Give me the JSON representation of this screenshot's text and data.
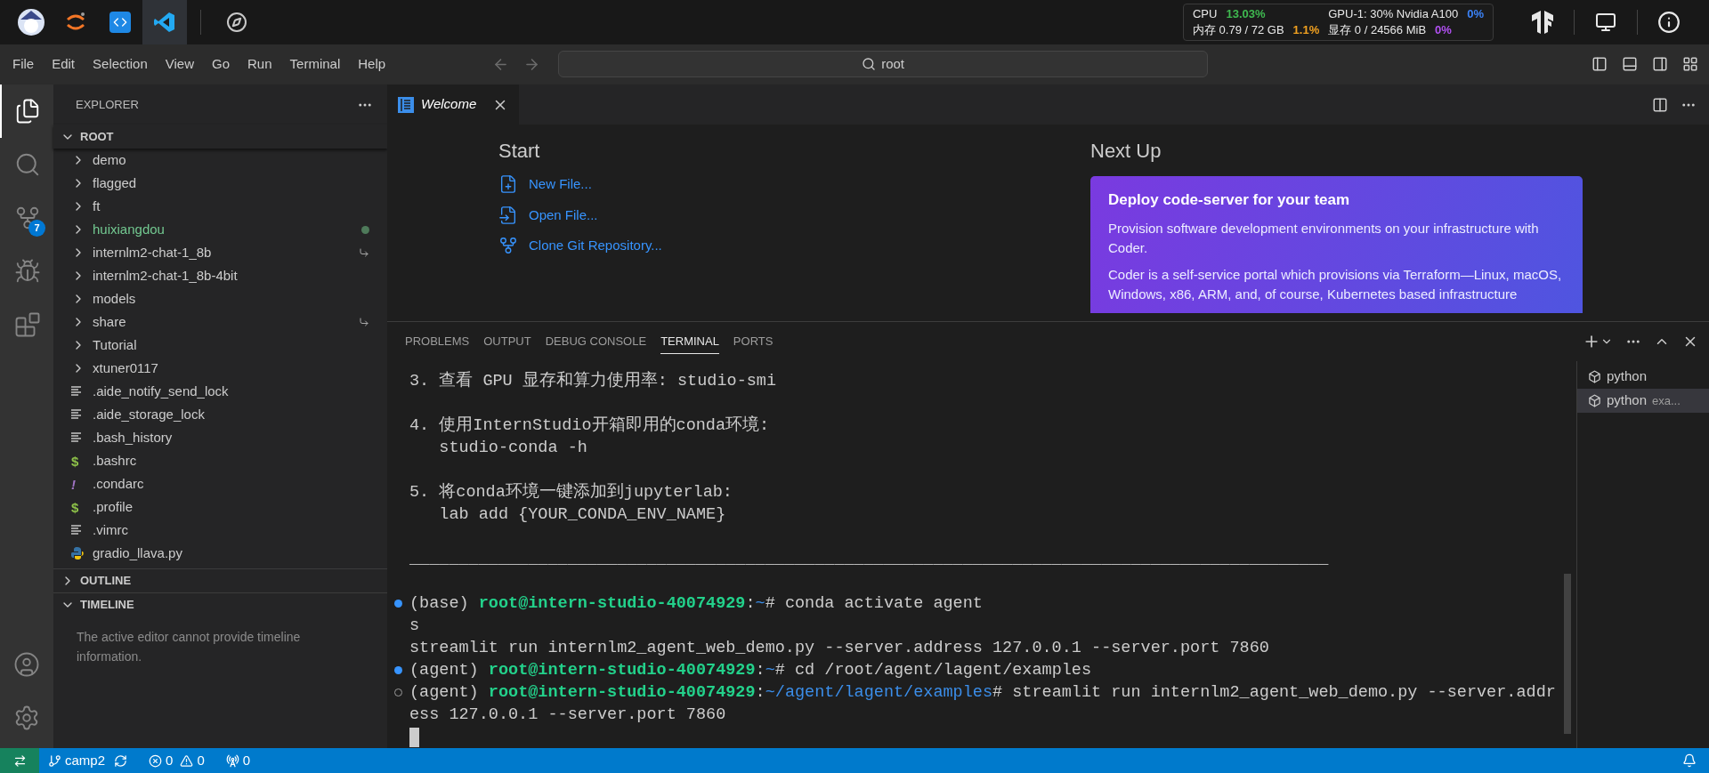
{
  "topbar": {
    "apps": [
      {
        "kind": "mascot",
        "selected": false
      },
      {
        "kind": "jupyter",
        "selected": false
      },
      {
        "kind": "code",
        "selected": false
      },
      {
        "kind": "vscode",
        "selected": true
      },
      {
        "kind": "compass",
        "selected": false
      }
    ],
    "monitor": [
      [
        {
          "label": "CPU",
          "value": "13.03%",
          "color": "#3fb950"
        },
        {
          "label": "GPU-1: 30% Nvidia A100",
          "value": "0%",
          "color": "#3b82f6"
        }
      ],
      [
        {
          "label": "内存 0.79 / 72 GB",
          "value": "1.1%",
          "color": "#f0a020"
        },
        {
          "label": "显存 0 / 24566 MiB",
          "value": "0%",
          "color": "#b050f0"
        }
      ]
    ],
    "right_icons": [
      {
        "kind": "tf"
      },
      {
        "kind": "monitor"
      },
      {
        "kind": "info"
      }
    ]
  },
  "menu": [
    "File",
    "Edit",
    "Selection",
    "View",
    "Go",
    "Run",
    "Terminal",
    "Help"
  ],
  "command_center": {
    "title": "root"
  },
  "activity_bar": {
    "items": [
      {
        "kind": "explorer",
        "selected": true
      },
      {
        "kind": "search",
        "selected": false
      },
      {
        "kind": "source_control",
        "selected": false,
        "badge": "7"
      },
      {
        "kind": "run_debug",
        "selected": false
      },
      {
        "kind": "extensions",
        "selected": false
      }
    ],
    "bottom": [
      {
        "kind": "accounts"
      },
      {
        "kind": "settings"
      }
    ]
  },
  "sidebar": {
    "title": "EXPLORER",
    "section": "ROOT",
    "items": [
      {
        "kind": "folder",
        "name": "demo"
      },
      {
        "kind": "folder",
        "name": "flagged"
      },
      {
        "kind": "folder",
        "name": "ft"
      },
      {
        "kind": "folder",
        "name": "huixiangdou",
        "untracked": true
      },
      {
        "kind": "folder",
        "name": "internlm2-chat-1_8b",
        "symlink": true
      },
      {
        "kind": "folder",
        "name": "internlm2-chat-1_8b-4bit"
      },
      {
        "kind": "folder",
        "name": "models"
      },
      {
        "kind": "folder",
        "name": "share",
        "symlink": true
      },
      {
        "kind": "folder",
        "name": "Tutorial"
      },
      {
        "kind": "folder",
        "name": "xtuner0117"
      },
      {
        "kind": "text",
        "name": ".aide_notify_send_lock"
      },
      {
        "kind": "text",
        "name": ".aide_storage_lock"
      },
      {
        "kind": "text",
        "name": ".bash_history"
      },
      {
        "kind": "shell",
        "glyph": "$",
        "name": ".bashrc"
      },
      {
        "kind": "config",
        "glyph": "!",
        "name": ".condarc"
      },
      {
        "kind": "shell",
        "glyph": "$",
        "name": ".profile"
      },
      {
        "kind": "text",
        "name": ".vimrc"
      },
      {
        "kind": "python",
        "name": "gradio_llava.py"
      }
    ],
    "outline": {
      "title": "OUTLINE",
      "expanded": false
    },
    "timeline": {
      "title": "TIMELINE",
      "expanded": true,
      "message": "The active editor cannot provide timeline information."
    }
  },
  "editor": {
    "tabs": [
      {
        "label": "Welcome",
        "selected": true
      }
    ],
    "start": {
      "title": "Start",
      "actions": [
        {
          "kind": "new_file",
          "label": "New File..."
        },
        {
          "kind": "open_file",
          "label": "Open File..."
        },
        {
          "kind": "clone",
          "label": "Clone Git Repository..."
        }
      ]
    },
    "next_up": {
      "title": "Next Up",
      "card": {
        "title": "Deploy code-server for your team",
        "paragraphs": [
          "Provision software development environments on your infrastructure with Coder.",
          "Coder is a self-service portal which provisions via Terraform—Linux, macOS, Windows, x86, ARM, and, of course, Kubernetes based infrastructure"
        ]
      }
    }
  },
  "panel": {
    "tabs": [
      {
        "label": "PROBLEMS",
        "selected": false
      },
      {
        "label": "OUTPUT",
        "selected": false
      },
      {
        "label": "DEBUG CONSOLE",
        "selected": false
      },
      {
        "label": "TERMINAL",
        "selected": true
      },
      {
        "label": "PORTS",
        "selected": false
      }
    ],
    "terminal_lines": [
      {
        "kind": "text",
        "text": "3. 查看 GPU 显存和算力使用率: studio-smi"
      },
      {
        "kind": "blank"
      },
      {
        "kind": "text",
        "text": "4. 使用InternStudio开箱即用的conda环境:"
      },
      {
        "kind": "text",
        "text": "   studio-conda -h"
      },
      {
        "kind": "blank"
      },
      {
        "kind": "text",
        "text": "5. 将conda环境一键添加到jupyterlab:"
      },
      {
        "kind": "text",
        "text": "   lab add {YOUR_CONDA_ENV_NAME}"
      },
      {
        "kind": "blank"
      },
      {
        "kind": "text",
        "text": "_____________________________________________________________________________________________"
      },
      {
        "kind": "blank"
      },
      {
        "kind": "prompt",
        "finished": true,
        "env": "(base) ",
        "user": "root@intern-studio-40074929",
        "sep": ":",
        "path": "~",
        "command": "# conda activate agent"
      },
      {
        "kind": "text",
        "text": "s"
      },
      {
        "kind": "text",
        "text": "streamlit run internlm2_agent_web_demo.py --server.address 127.0.0.1 --server.port 7860"
      },
      {
        "kind": "prompt",
        "finished": true,
        "env": "(agent) ",
        "user": "root@intern-studio-40074929",
        "sep": ":",
        "path": "~",
        "command": "# cd /root/agent/lagent/examples"
      },
      {
        "kind": "prompt",
        "finished": false,
        "env": "(agent) ",
        "user": "root@intern-studio-40074929",
        "sep": ":",
        "path": "~/agent/lagent/examples",
        "command": "# streamlit run internlm2_agent_web_demo.py --server.addr"
      },
      {
        "kind": "text",
        "text": "ess 127.0.0.1 --server.port 7860"
      },
      {
        "kind": "cursor"
      }
    ],
    "terminals": [
      {
        "label": "python",
        "selected": false
      },
      {
        "label": "python",
        "detail": "exa...",
        "selected": true
      }
    ]
  },
  "status_bar": {
    "branch": "camp2",
    "errors": "0",
    "warnings": "0",
    "ports": "0"
  }
}
